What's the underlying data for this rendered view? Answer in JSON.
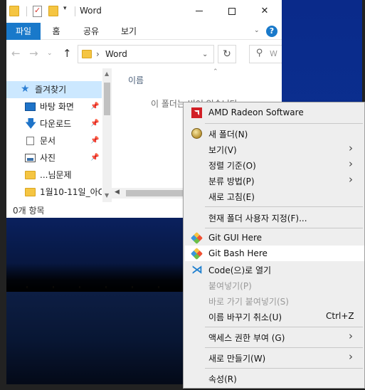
{
  "window": {
    "title": "Word",
    "qa_dropdown": "▾"
  },
  "ribbon": {
    "tabs": [
      "파일",
      "홈",
      "공유",
      "보기"
    ],
    "help": "?"
  },
  "address": {
    "path_chevron": "›",
    "path": "Word",
    "search_placeholder": "W"
  },
  "nav_pane": {
    "items": [
      {
        "label": "즐겨찾기",
        "icon": "star-icon",
        "pinned": false
      },
      {
        "label": "바탕 화면",
        "icon": "desktop-icon",
        "pinned": true
      },
      {
        "label": "다운로드",
        "icon": "download-icon",
        "pinned": true
      },
      {
        "label": "문서",
        "icon": "document-icon",
        "pinned": true
      },
      {
        "label": "사진",
        "icon": "pictures-icon",
        "pinned": true
      },
      {
        "label": "...님문제",
        "icon": "folder-icon",
        "pinned": false
      },
      {
        "label": "1월10-11일_아C",
        "icon": "folder-icon",
        "pinned": false
      }
    ]
  },
  "content": {
    "column_name": "이름",
    "empty_message": "이 폴더는 비어 있습니다."
  },
  "status": {
    "item_count": "0개 항목"
  },
  "context_menu": {
    "items": [
      {
        "label": "AMD Radeon Software",
        "icon": "amd-icon"
      },
      {
        "label": "새 폴더(N)",
        "icon": "new-folder-icon"
      },
      {
        "label": "보기(V)",
        "submenu": true
      },
      {
        "label": "정렬 기준(O)",
        "submenu": true
      },
      {
        "label": "분류 방법(P)",
        "submenu": true
      },
      {
        "label": "새로 고침(E)"
      },
      {
        "label": "현재 폴더 사용자 지정(F)..."
      },
      {
        "label": "Git GUI Here",
        "icon": "git-icon"
      },
      {
        "label": "Git Bash Here",
        "icon": "git-icon",
        "highlighted": true
      },
      {
        "label": "Code(으)로 열기",
        "icon": "vscode-icon"
      },
      {
        "label": "붙여넣기(P)",
        "disabled": true
      },
      {
        "label": "바로 가기 붙여넣기(S)",
        "disabled": true
      },
      {
        "label": "이름 바꾸기 취소(U)",
        "shortcut": "Ctrl+Z"
      },
      {
        "label": "액세스 권한 부여 (G)",
        "submenu": true
      },
      {
        "label": "새로 만들기(W)",
        "submenu": true
      },
      {
        "label": "속성(R)"
      }
    ]
  },
  "colors": {
    "accent": "#1979ca",
    "selection": "#cce8ff",
    "menu_bg": "#eeeeee",
    "amd_red": "#d11f26"
  }
}
